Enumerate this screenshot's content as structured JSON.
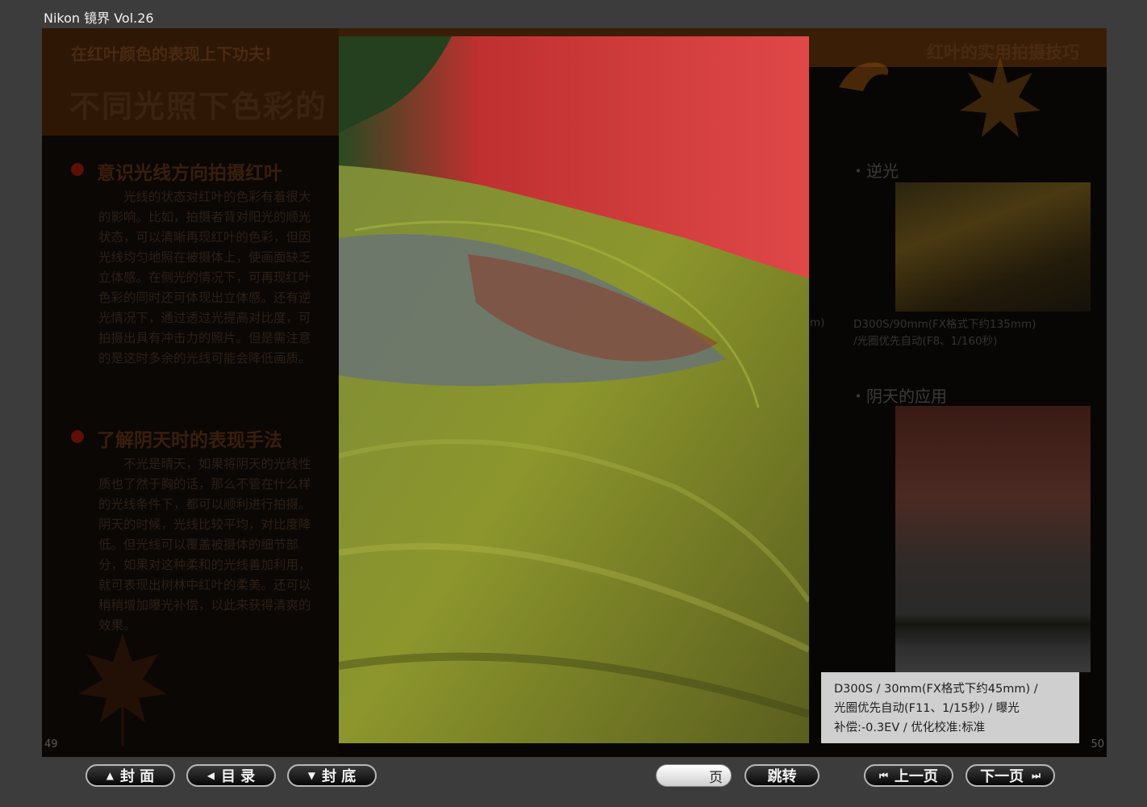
{
  "window": {
    "title": "Nikon 镜界 Vol.26"
  },
  "left_page": {
    "header": "在红叶颜色的表现上下功夫!",
    "headline": "不同光照下色彩的",
    "sections": [
      {
        "title": "意识光线方向拍摄红叶",
        "body": "光线的状态对红叶的色彩有着很大的影响。比如，拍摄者背对阳光的顺光状态，可以清晰再现红叶的色彩，但因光线均匀地照在被摄体上，使画面缺乏立体感。在侧光的情况下，可再现红叶色彩的同时还可体现出立体感。还有逆光情况下，通过透过光提高对比度，可拍摄出具有冲击力的照片。但是需注意的是这时多余的光线可能会降低画质。"
      },
      {
        "title": "了解阴天时的表现手法",
        "body": "不光是晴天，如果将阴天的光线性质也了然于胸的话，那么不管在什么样的光线条件下，都可以顺利进行拍摄。阴天的时候，光线比较平均，对比度降低。但光线可以覆盖被摄体的细节部分，如果对这种柔和的光线善加利用，就可表现出树林中红叶的柔美。还可以稍稍增加曝光补偿，以此来获得清爽的效果。"
      }
    ],
    "page_number": "49"
  },
  "right_page": {
    "header": "红叶的实用拍摄技巧",
    "items": [
      {
        "label": "・逆光",
        "caption_line1": "D300S/90mm(FX格式下约135mm)",
        "caption_line2": "/光圈优先自动(F8、1/160秒)"
      },
      {
        "label": "・阴天的应用"
      }
    ],
    "cut_off_text": "m)",
    "page_number": "50"
  },
  "photo_caption": {
    "line1": "D300S / 30mm(FX格式下约45mm) /",
    "line2": "光圈优先自动(F11、1/15秒) / 曝光",
    "line3": "补偿:-0.3EV / 优化校准:标准"
  },
  "toolbar": {
    "cover_label": "封 面",
    "contents_label": "目 录",
    "back_cover_label": "封 底",
    "page_suffix": "页",
    "jump_label": "跳转",
    "prev_label": "上一页",
    "next_label": "下一页"
  },
  "colors": {
    "background": "#3c3c3c",
    "banner": "#3a1f06",
    "bullet": "#5c0f06"
  },
  "icons": [
    "triangle-up-icon",
    "triangle-left-icon",
    "triangle-down-icon",
    "skip-back-icon",
    "skip-forward-icon"
  ]
}
